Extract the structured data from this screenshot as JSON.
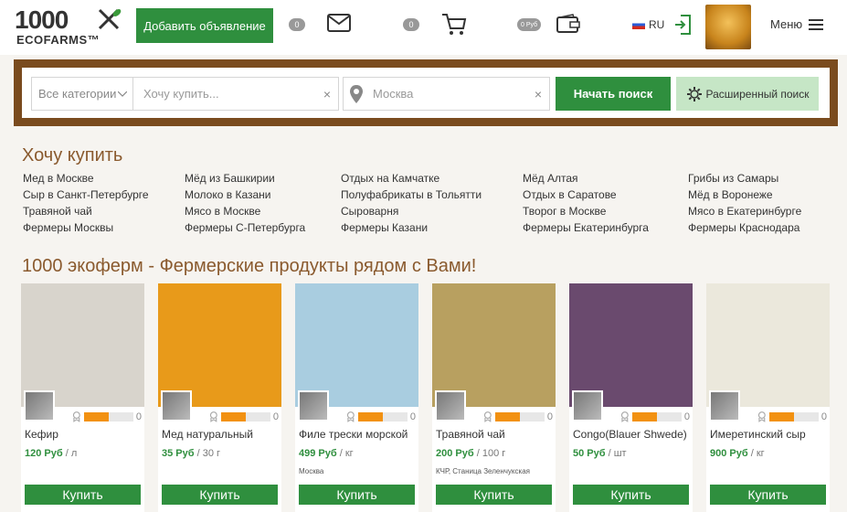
{
  "header": {
    "logo_number": "1000",
    "logo_text": "ECOFARMS™",
    "add_listing_label": "Добавить объявление",
    "messages_count": "0",
    "cart_count": "0",
    "wallet_amount": "0 Руб",
    "language": "RU",
    "menu_label": "Меню",
    "icons": [
      "envelope-icon",
      "cart-icon",
      "wallet-icon",
      "login-icon",
      "hamburger-icon"
    ]
  },
  "search": {
    "category_placeholder": "Все категории",
    "query_placeholder": "Хочу купить...",
    "location_value": "Москва",
    "start_label": "Начать поиск",
    "advanced_label": "Расширенный поиск"
  },
  "want_to_buy": {
    "title": "Хочу купить",
    "columns": [
      [
        "Мед в Москве",
        "Сыр в Санкт-Петербурге",
        "Травяной чай",
        "Фермеры Москвы"
      ],
      [
        "Мёд из Башкирии",
        "Молоко в Казани",
        "Мясо в Москве",
        "Фермеры С-Петербурга"
      ],
      [
        "Отдых на Камчатке",
        "Полуфабрикаты в Тольятти",
        "Сыроварня",
        "Фермеры Казани"
      ],
      [
        "Мёд Алтая",
        "Отдых в Саратове",
        "Творог в Москве",
        "Фермеры Екатеринбурга"
      ],
      [
        "Грибы из Самары",
        "Мёд в Воронеже",
        "Мясо в Екатеринбурге",
        "Фермеры Краснодара"
      ]
    ]
  },
  "products": {
    "title": "1000 экоферм - Фермерские продукты рядом с Вами!",
    "buy_label": "Купить",
    "items": [
      {
        "name": "Кефир",
        "price": "120 Руб",
        "unit": "/ л",
        "location": "",
        "rating": "0",
        "rating_fill": 0.5,
        "image_color": "#d8d4cc"
      },
      {
        "name": "Мед натуральный",
        "price": "35 Руб",
        "unit": "/ 30 г",
        "location": "",
        "rating": "0",
        "rating_fill": 0.5,
        "image_color": "#e89a1a"
      },
      {
        "name": "Филе трески морской",
        "price": "499 Руб",
        "unit": "/ кг",
        "location": "Москва",
        "rating": "0",
        "rating_fill": 0.5,
        "image_color": "#a9cde0"
      },
      {
        "name": "Травяной чай",
        "price": "200 Руб",
        "unit": "/ 100 г",
        "location": "КЧР, Станица Зеленчукская",
        "rating": "0",
        "rating_fill": 0.5,
        "image_color": "#b8a060"
      },
      {
        "name": "Congo(Blauer Shwede)",
        "price": "50 Руб",
        "unit": "/ шт",
        "location": "",
        "rating": "0",
        "rating_fill": 0.5,
        "image_color": "#6a4a6e"
      },
      {
        "name": "Имеретинский сыр",
        "price": "900 Руб",
        "unit": "/ кг",
        "location": "",
        "rating": "0",
        "rating_fill": 0.5,
        "image_color": "#ebe8dc"
      }
    ]
  }
}
